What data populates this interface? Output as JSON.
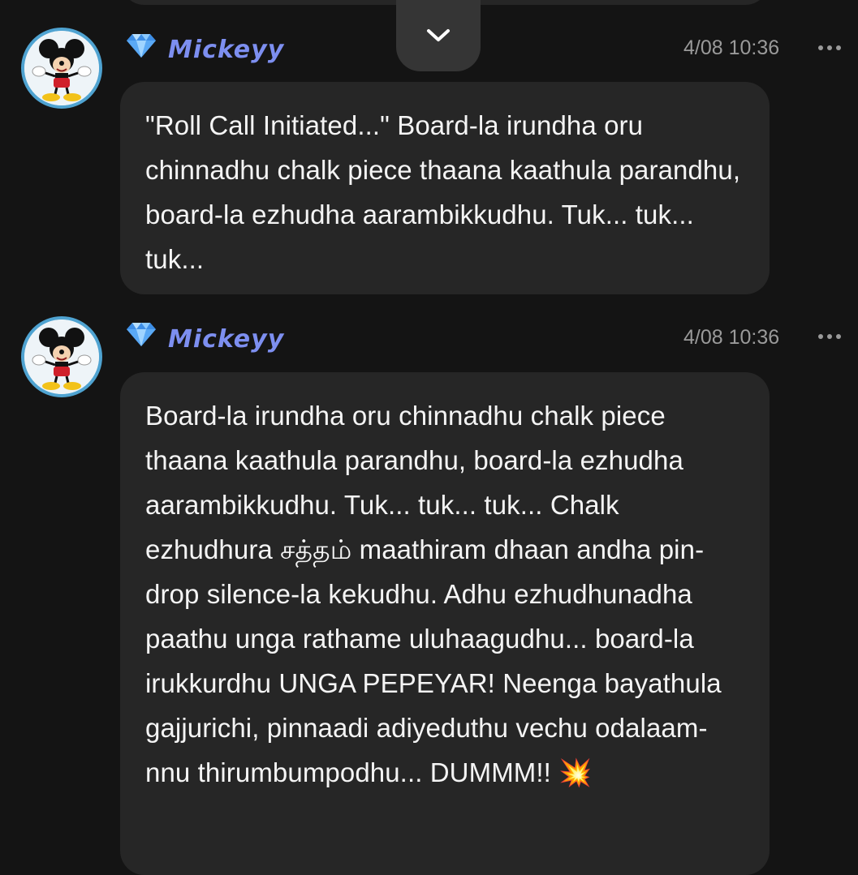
{
  "scroll_button": {
    "icon": "chevron-down-icon"
  },
  "messages": [
    {
      "username": "Mickeyy",
      "badge_icon": "diamond-icon",
      "timestamp": "4/08 10:36",
      "text": "\"Roll Call Initiated...\" Board-la irundha oru chinnadhu chalk piece thaana kaathula parandhu, board-la ezhudha aarambikkudhu. Tuk... tuk... tuk..."
    },
    {
      "username": "Mickeyy",
      "badge_icon": "diamond-icon",
      "timestamp": "4/08 10:36",
      "text": "Board-la irundha oru chinnadhu chalk piece thaana kaathula parandhu, board-la ezhudha aarambikkudhu. Tuk... tuk... tuk... Chalk ezhudhura சத்தம் maathiram dhaan andha pin-drop silence-la kekudhu. Adhu ezhudhunadha paathu unga rathame uluhaagudhu... board-la irukkurdhu UNGA PEPEYAR! Neenga bayathula gajjurichi, pinnaadi adiyeduthu vechu odalaam-nnu thirumbumpodhu... DUMMM!! 💥"
    }
  ],
  "colors": {
    "background": "#141414",
    "bubble": "#262626",
    "username": "#7d8ff0",
    "timestamp": "#9a9a9a",
    "avatar_ring": "#4fa3d1"
  }
}
